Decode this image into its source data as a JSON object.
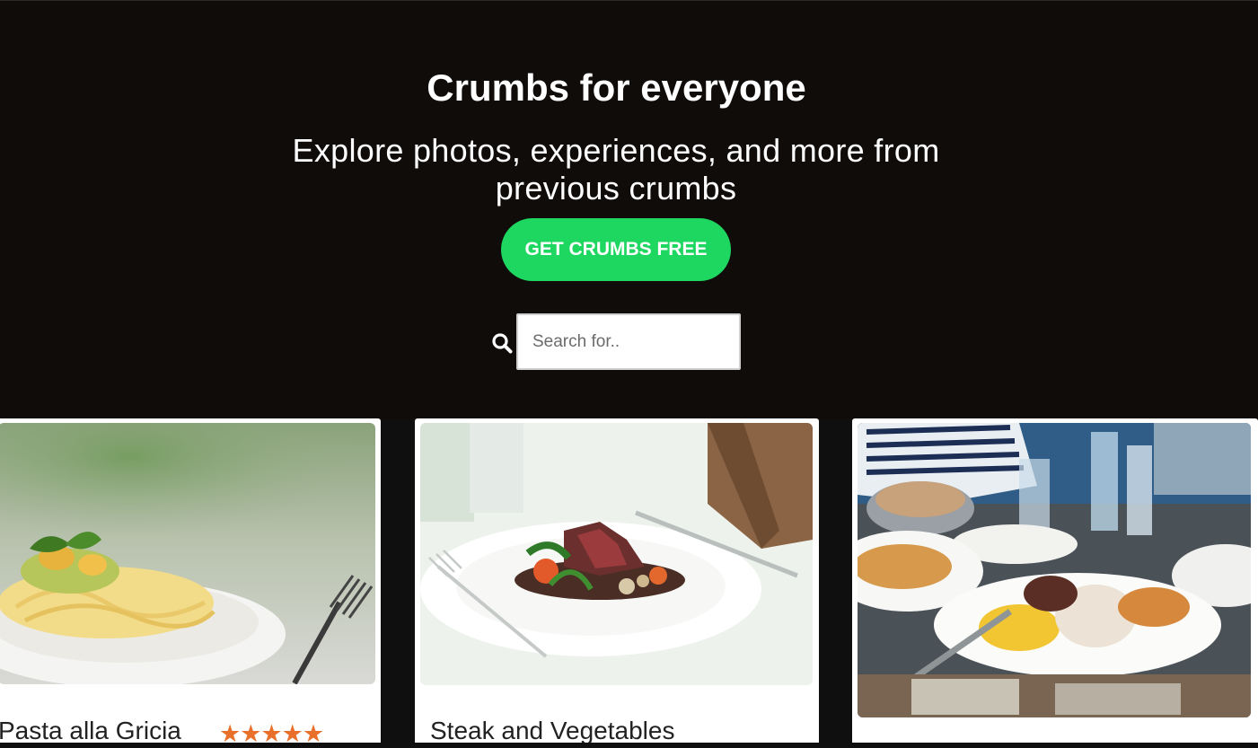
{
  "hero": {
    "title": "Crumbs for everyone",
    "subtitle": "Explore photos, experiences, and more from previous crumbs",
    "cta_label": "GET CRUMBS FREE"
  },
  "search": {
    "placeholder": "Search for..",
    "value": ""
  },
  "cards": [
    {
      "title": "Pasta alla Gricia",
      "rating": "★★★★★",
      "image": "pasta-photo"
    },
    {
      "title": "Steak and Vegetables",
      "rating": "",
      "image": "steak-photo"
    },
    {
      "title": "",
      "rating": "",
      "image": "seafood-platter-photo"
    }
  ],
  "colors": {
    "background": "#100c0a",
    "accent": "#1ed760",
    "star": "#e8702a"
  }
}
